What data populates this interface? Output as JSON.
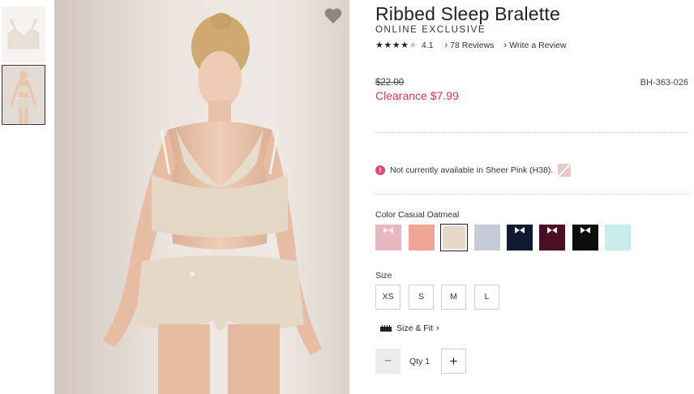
{
  "thumbnails": [
    {
      "alt_icon": "bralette-product-thumbnail"
    },
    {
      "alt_icon": "model-photo-thumbnail"
    }
  ],
  "product": {
    "title": "Ribbed Sleep Bralette",
    "subtitle": "ONLINE EXCLUSIVE",
    "rating": 4.1,
    "rating_text": "4.1",
    "stars_filled": 4,
    "reviews_link": "78 Reviews",
    "write_review_link": "Write a Review",
    "was_price": "$22.00",
    "sale_price": "Clearance $7.99",
    "sku": "BH-363-026",
    "availability_notice": "Not currently available in Sheer Pink (H38).",
    "color_label": "Color Casual Oatmeal",
    "size_label": "Size",
    "sizes": [
      "XS",
      "S",
      "M",
      "L"
    ],
    "size_fit_link": "Size & Fit",
    "qty_label": "Qty 1",
    "qty_minus": "−",
    "qty_plus": "+"
  },
  "colors": {
    "accent_sale": "#d6336c",
    "alert": "#e0497b",
    "swatches": [
      "#e7b8bf",
      "#f0a493",
      "#e6d9c7",
      "#c6cbd9",
      "#101a33",
      "#4c0f22",
      "#0d0d0d",
      "#c9ecec"
    ],
    "selected_swatch_index": 2
  }
}
